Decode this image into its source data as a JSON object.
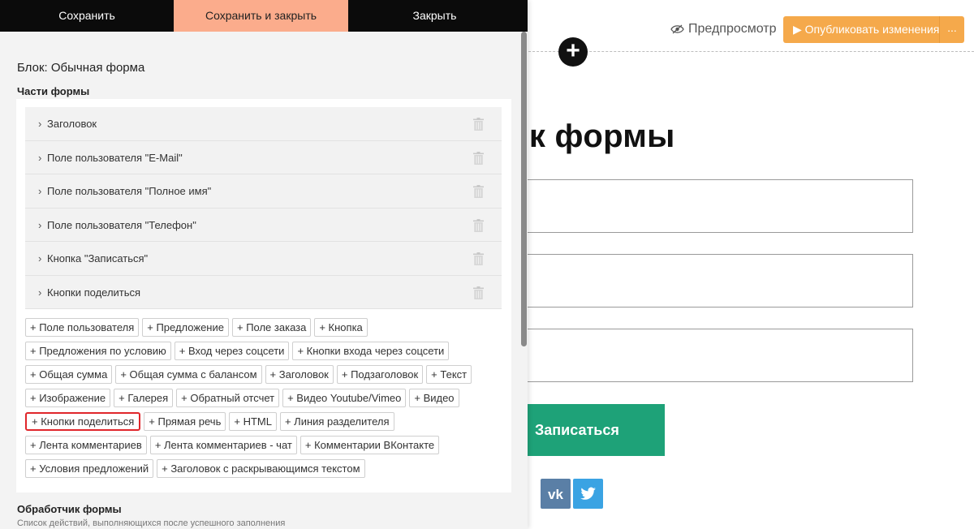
{
  "panel": {
    "tabs": {
      "save": "Сохранить",
      "save_close": "Сохранить и закрыть",
      "close": "Закрыть"
    },
    "block_title": "Блок: Обычная форма",
    "parts_label": "Части формы",
    "parts": [
      {
        "label": "Заголовок"
      },
      {
        "label": "Поле пользователя \"E-Mail\""
      },
      {
        "label": "Поле пользователя \"Полное имя\""
      },
      {
        "label": "Поле пользователя \"Телефон\""
      },
      {
        "label": "Кнопка \"Записаться\""
      },
      {
        "label": "Кнопки поделиться"
      }
    ],
    "add_rows": [
      [
        "+ Поле пользователя",
        "+ Предложение",
        "+ Поле заказа",
        "+ Кнопка"
      ],
      [
        "+ Предложения по условию",
        "+ Вход через соцсети",
        "+ Кнопки входа через соцсети"
      ],
      [
        "+ Общая сумма",
        "+ Общая сумма с балансом",
        "+ Заголовок",
        "+ Подзаголовок",
        "+ Текст"
      ],
      [
        "+ Изображение",
        "+ Галерея",
        "+ Обратный отсчет",
        "+ Видео Youtube/Vimeo",
        "+ Видео"
      ],
      [
        "+ Кнопки поделиться",
        "+ Прямая речь",
        "+ HTML",
        "+ Линия разделителя"
      ],
      [
        "+ Лента комментариев",
        "+ Лента комментариев - чат",
        "+ Комментарии ВКонтакте"
      ],
      [
        "+ Условия предложений",
        "+ Заголовок с раскрывающимся текстом"
      ]
    ],
    "highlighted_add": "+ Кнопки поделиться",
    "handler_title": "Обработчик формы",
    "handler_subtitle": "Список действий, выполняющихся после успешного заполнения"
  },
  "preview": {
    "preview_label": "Предпросмотр",
    "publish_label": "▶ Опубликовать изменения",
    "publish_more": "...",
    "add_block": "+",
    "form_title": "овок формы",
    "submit_label": "Записаться",
    "share_vk": "vk",
    "share_twitter": "t"
  },
  "colors": {
    "accent_tab": "#fbac8c",
    "publish": "#f5a94b",
    "submit": "#1ea278",
    "vk": "#5a7fa6",
    "twitter": "#3aa3e3",
    "highlight": "#e0262b"
  }
}
